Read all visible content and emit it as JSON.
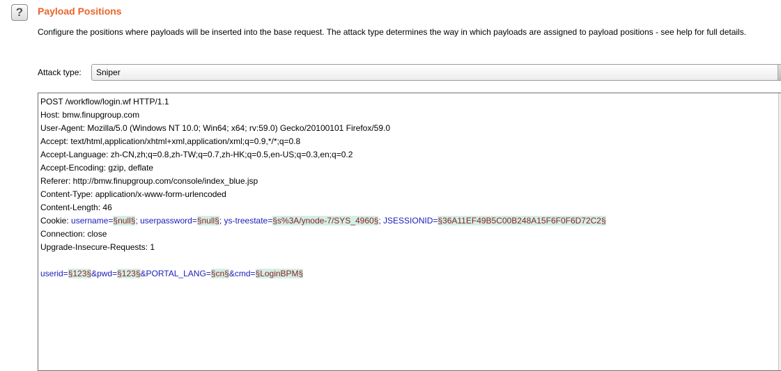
{
  "header": {
    "help_glyph": "?",
    "title": "Payload Positions",
    "description": "Configure the positions where payloads will be inserted into the base request. The attack type determines the way in which payloads are assigned to payload positions - see help for full details."
  },
  "attack": {
    "label": "Attack type:",
    "selected": "Sniper"
  },
  "request": {
    "lines": [
      "POST /workflow/login.wf HTTP/1.1",
      "Host: bmw.finupgroup.com",
      "User-Agent: Mozilla/5.0 (Windows NT 10.0; Win64; x64; rv:59.0) Gecko/20100101 Firefox/59.0",
      "Accept: text/html,application/xhtml+xml,application/xml;q=0.9,*/*;q=0.8",
      "Accept-Language: zh-CN,zh;q=0.8,zh-TW;q=0.7,zh-HK;q=0.5,en-US;q=0.3,en;q=0.2",
      "Accept-Encoding: gzip, deflate",
      "Referer: http://bmw.finupgroup.com/console/index_blue.jsp",
      "Content-Type: application/x-www-form-urlencoded",
      "Content-Length: 46"
    ],
    "cookie": {
      "prefix": "Cookie: ",
      "pairs": [
        {
          "name": "username=",
          "marker": "§null§",
          "sep": "; "
        },
        {
          "name": "userpassword=",
          "marker": "§null§",
          "sep": "; "
        },
        {
          "name": "ys-treestate=",
          "marker": "§s%3A/ynode-7/SYS_4960§",
          "sep": "; "
        },
        {
          "name": "JSESSIONID=",
          "marker": "§36A11EF49B5C00B248A15F6F0F6D72C2§",
          "sep": ""
        }
      ]
    },
    "lines_after": [
      "Connection: close",
      "Upgrade-Insecure-Requests: 1",
      ""
    ],
    "body": {
      "pairs": [
        {
          "name": "userid=",
          "marker": "§123§",
          "sep": "&"
        },
        {
          "name": "pwd=",
          "marker": "§123§",
          "sep": "&"
        },
        {
          "name": "PORTAL_LANG=",
          "marker": "§cn§",
          "sep": "&"
        },
        {
          "name": "cmd=",
          "marker": "§LoginBPM§",
          "sep": ""
        }
      ]
    }
  }
}
